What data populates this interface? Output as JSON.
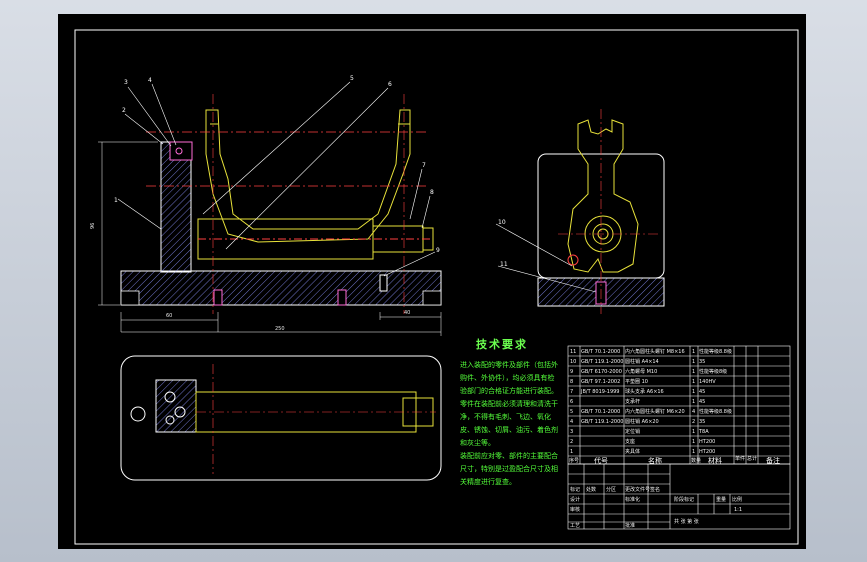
{
  "tech_requirements": {
    "title": "技术要求",
    "lines": [
      "进入装配的零件及部件（包括外",
      "购件、外协件），均必须具有检",
      "验部门的合格证方能进行装配。",
      "零件在装配前必须清理和清洗干",
      "净，不得有毛刺、飞边、氧化",
      "皮、锈蚀、切屑、油污、着色剂",
      "和灰尘等。",
      "装配前应对零、部件的主要配合",
      "尺寸，特别是过盈配合尺寸及相",
      "关精度进行复查。"
    ]
  },
  "callouts": [
    "1",
    "2",
    "3",
    "4",
    "5",
    "6",
    "7",
    "8",
    "9",
    "10",
    "11"
  ],
  "dimensions": {
    "height": "96",
    "width_a": "60",
    "width_b": "250",
    "width_c": "40"
  },
  "parts_table": {
    "header": {
      "no": "序号",
      "code": "代号",
      "name": "名称",
      "qty": "数量",
      "material": "材料",
      "unit_weight": "单件",
      "total_weight": "总计",
      "remark": "备注"
    },
    "rows": [
      [
        "11",
        "GB/T 70.1-2000",
        "内六角圆柱头螺钉 M8×16",
        "1",
        "性能等级8.8级",
        ""
      ],
      [
        "10",
        "GB/T 119.1-2000",
        "圆柱销 A4×14",
        "1",
        "35",
        ""
      ],
      [
        "9",
        "GB/T 6170-2000",
        "六角螺母 M10",
        "1",
        "性能等级8级",
        ""
      ],
      [
        "8",
        "GB/T 97.1-2002",
        "平垫圈 10",
        "1",
        "140HV",
        ""
      ],
      [
        "7",
        "JB/T 8019-1999",
        "球头支承 A6×16",
        "1",
        "45",
        ""
      ],
      [
        "6",
        "",
        "支承杆",
        "1",
        "45",
        ""
      ],
      [
        "5",
        "GB/T 70.1-2000",
        "内六角圆柱头螺钉 M6×20",
        "4",
        "性能等级8.8级",
        ""
      ],
      [
        "4",
        "GB/T 119.1-2000",
        "圆柱销 A6×20",
        "2",
        "35",
        ""
      ],
      [
        "3",
        "",
        "定位销",
        "1",
        "T8A",
        ""
      ],
      [
        "2",
        "",
        "支座",
        "1",
        "HT200",
        ""
      ],
      [
        "1",
        "",
        "夹具体",
        "1",
        "HT200",
        ""
      ]
    ]
  },
  "title_block": {
    "labels": [
      "标记",
      "处数",
      "分区",
      "更改文件号",
      "签名",
      "年月日"
    ],
    "roles": [
      "设计",
      "标准化",
      "审核",
      "工艺",
      "批准"
    ],
    "stage": "阶段标记",
    "weight": "重量",
    "scale": "比例",
    "scale_value": "1:1",
    "sheets": "共 张 第 张"
  },
  "colors": {
    "background": "#000000",
    "frame": "#ffffff",
    "part_outline": "#ffffff",
    "hatch": "#9aa0ff",
    "centerline": "#ff4040",
    "yellow_part": "#e8e23a",
    "cyan_line": "#40e0ff",
    "text_green": "#54ff3a",
    "pink": "#ff6bd6"
  }
}
